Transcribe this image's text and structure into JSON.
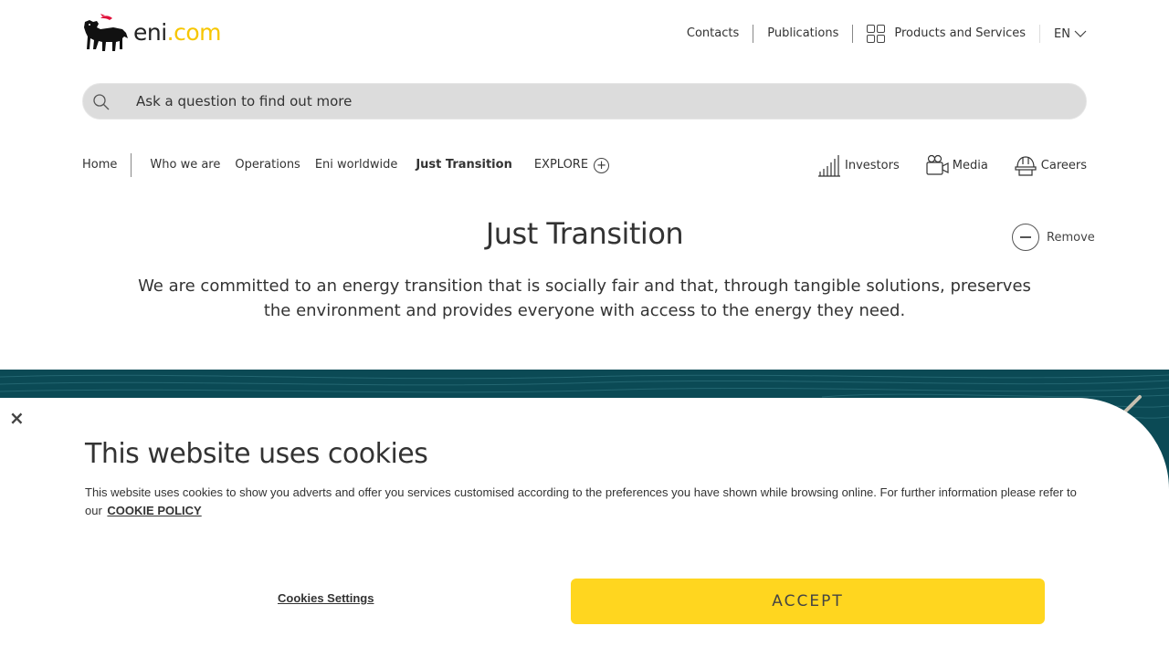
{
  "header": {
    "logo": {
      "brand": "eni",
      "dot": ".",
      "tld": "com"
    },
    "top_links": [
      {
        "label": "Contacts"
      },
      {
        "label": "Publications"
      },
      {
        "label": "Products and Services",
        "icon": "grid-icon"
      }
    ],
    "language": "EN"
  },
  "search": {
    "placeholder": "Ask a question to find out more"
  },
  "nav": {
    "home": "Home",
    "items": [
      "Who we are",
      "Operations",
      "Eni worldwide"
    ],
    "active": "Just Transition",
    "explore": "EXPLORE",
    "right_items": [
      {
        "label": "Investors",
        "icon": "investors-chart-icon"
      },
      {
        "label": "Media",
        "icon": "video-camera-icon"
      },
      {
        "label": "Careers",
        "icon": "hard-hat-icon"
      }
    ]
  },
  "page": {
    "title": "Just Transition",
    "remove_label": "Remove",
    "description": "We are committed to an energy transition that is socially fair and that, through tangible solutions, preserves the environment and provides everyone with access to the energy they need."
  },
  "cookie_banner": {
    "title": "This website uses cookies",
    "text": "This website uses cookies to show you adverts and offer you services customised according to the preferences you have shown while browsing online. For further information please refer to our",
    "policy_link": "COOKIE POLICY",
    "settings_label": "Cookies Settings",
    "accept_label": "ACCEPT"
  },
  "colors": {
    "accent_yellow": "#ffd61f",
    "banner_teal": "#0b4a55",
    "search_bg": "#dcdcdc",
    "logo_red": "#e0103a"
  }
}
